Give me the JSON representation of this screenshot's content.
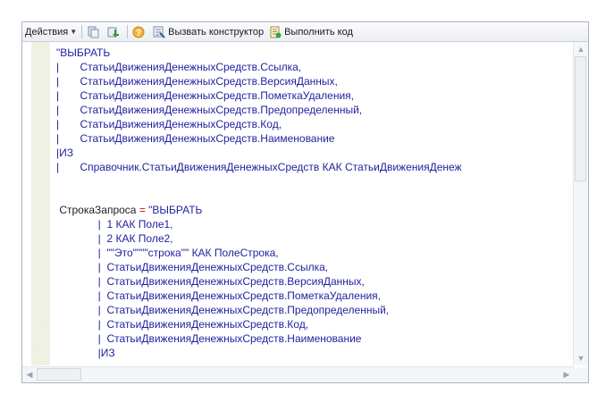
{
  "toolbar": {
    "actions_label": "Действия",
    "help_icon": "help-icon",
    "call_constructor_label": "Вызвать конструктор",
    "run_code_label": "Выполнить код"
  },
  "code_lines": [
    {
      "segs": [
        {
          "t": "\"ВЫБРАТЬ",
          "c": "kw"
        }
      ]
    },
    {
      "segs": [
        {
          "t": "|       ",
          "c": "kw"
        },
        {
          "t": "СтатьиДвиженияДенежныхСредств.Ссылка,",
          "c": "kw"
        }
      ]
    },
    {
      "segs": [
        {
          "t": "|       ",
          "c": "kw"
        },
        {
          "t": "СтатьиДвиженияДенежныхСредств.ВерсияДанных,",
          "c": "kw"
        }
      ]
    },
    {
      "segs": [
        {
          "t": "|       ",
          "c": "kw"
        },
        {
          "t": "СтатьиДвиженияДенежныхСредств.ПометкаУдаления,",
          "c": "kw"
        }
      ]
    },
    {
      "segs": [
        {
          "t": "|       ",
          "c": "kw"
        },
        {
          "t": "СтатьиДвиженияДенежныхСредств.Предопределенный,",
          "c": "kw"
        }
      ]
    },
    {
      "segs": [
        {
          "t": "|       ",
          "c": "kw"
        },
        {
          "t": "СтатьиДвиженияДенежныхСредств.Код,",
          "c": "kw"
        }
      ]
    },
    {
      "segs": [
        {
          "t": "|       ",
          "c": "kw"
        },
        {
          "t": "СтатьиДвиженияДенежныхСредств.Наименование",
          "c": "kw"
        }
      ]
    },
    {
      "segs": [
        {
          "t": "|ИЗ",
          "c": "kw"
        }
      ]
    },
    {
      "segs": [
        {
          "t": "|       ",
          "c": "kw"
        },
        {
          "t": "Справочник.СтатьиДвиженияДенежныхСредств КАК СтатьиДвиженияДенеж",
          "c": "kw"
        }
      ]
    },
    {
      "segs": []
    },
    {
      "segs": []
    },
    {
      "segs": [
        {
          "t": " СтрокаЗапроса",
          "c": "id"
        },
        {
          "t": " = ",
          "c": "op"
        },
        {
          "t": "\"ВЫБРАТЬ",
          "c": "kw"
        }
      ]
    },
    {
      "segs": [
        {
          "t": "              |  1 КАК Поле1,",
          "c": "kw"
        }
      ]
    },
    {
      "segs": [
        {
          "t": "              |  2 КАК Поле2,",
          "c": "kw"
        }
      ]
    },
    {
      "segs": [
        {
          "t": "              |  \"\"Это\"\"\"\"строка\"\" КАК ПолеСтрока,",
          "c": "kw"
        }
      ]
    },
    {
      "segs": [
        {
          "t": "              |  СтатьиДвиженияДенежныхСредств.Ссылка,",
          "c": "kw"
        }
      ]
    },
    {
      "segs": [
        {
          "t": "              |  СтатьиДвиженияДенежныхСредств.ВерсияДанных,",
          "c": "kw"
        }
      ]
    },
    {
      "segs": [
        {
          "t": "              |  СтатьиДвиженияДенежныхСредств.ПометкаУдаления,",
          "c": "kw"
        }
      ]
    },
    {
      "segs": [
        {
          "t": "              |  СтатьиДвиженияДенежныхСредств.Предопределенный,",
          "c": "kw"
        }
      ]
    },
    {
      "segs": [
        {
          "t": "              |  СтатьиДвиженияДенежныхСредств.Код,",
          "c": "kw"
        }
      ]
    },
    {
      "segs": [
        {
          "t": "              |  СтатьиДвиженияДенежныхСредств.Наименование",
          "c": "kw"
        }
      ]
    },
    {
      "segs": [
        {
          "t": "              |ИЗ",
          "c": "kw"
        }
      ]
    }
  ],
  "colors": {
    "keyword": "#1f1f9e",
    "operator": "#c01818",
    "identifier": "#1f1f1f"
  }
}
